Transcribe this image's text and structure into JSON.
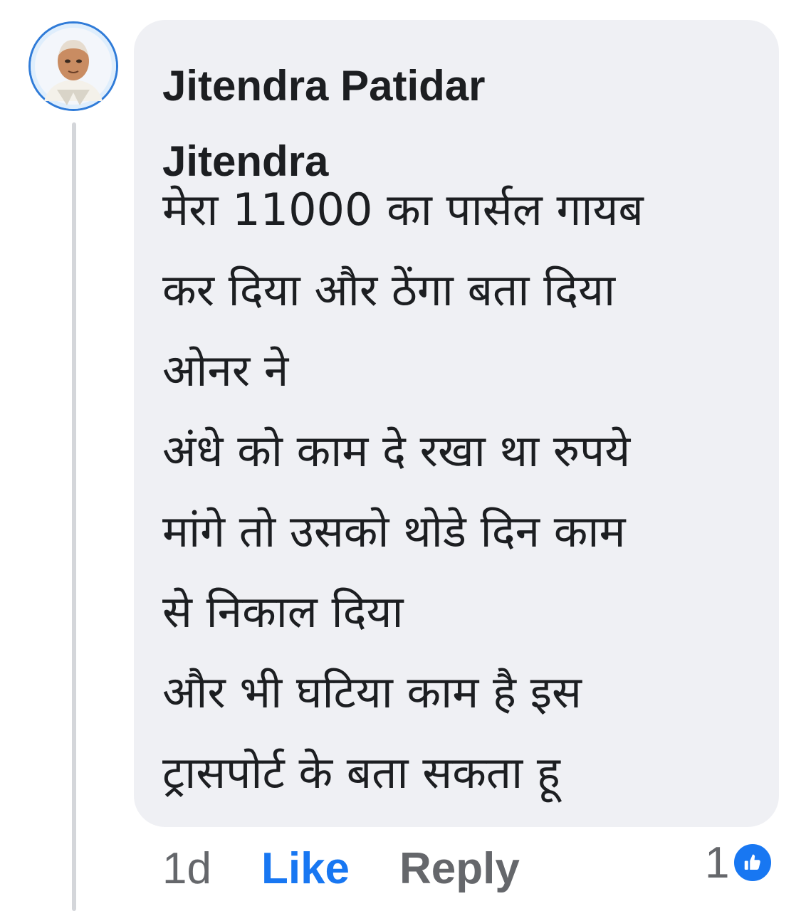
{
  "comment": {
    "author_line1": "Jitendra Patidar",
    "author_line2": "Jitendra",
    "lines": [
      "मेरा 11000 का पार्सल गायब",
      "कर दिया और ठेंगा बता दिया",
      "ओनर ने",
      "अंधे को काम दे रखा था रुपये",
      "मांगे तो उसको थोडे दिन काम",
      "से निकाल दिया",
      "और भी घटिया काम है इस",
      "ट्रासपोर्ट के बता सकता हू"
    ]
  },
  "actions": {
    "time": "1d",
    "like_label": "Like",
    "reply_label": "Reply",
    "reaction_count": "1"
  },
  "icons": {
    "avatar": "profile-photo",
    "reaction": "thumbs-up-icon"
  },
  "colors": {
    "like_blue": "#1877f2",
    "bubble": "#eff0f4",
    "muted": "#65676b"
  }
}
